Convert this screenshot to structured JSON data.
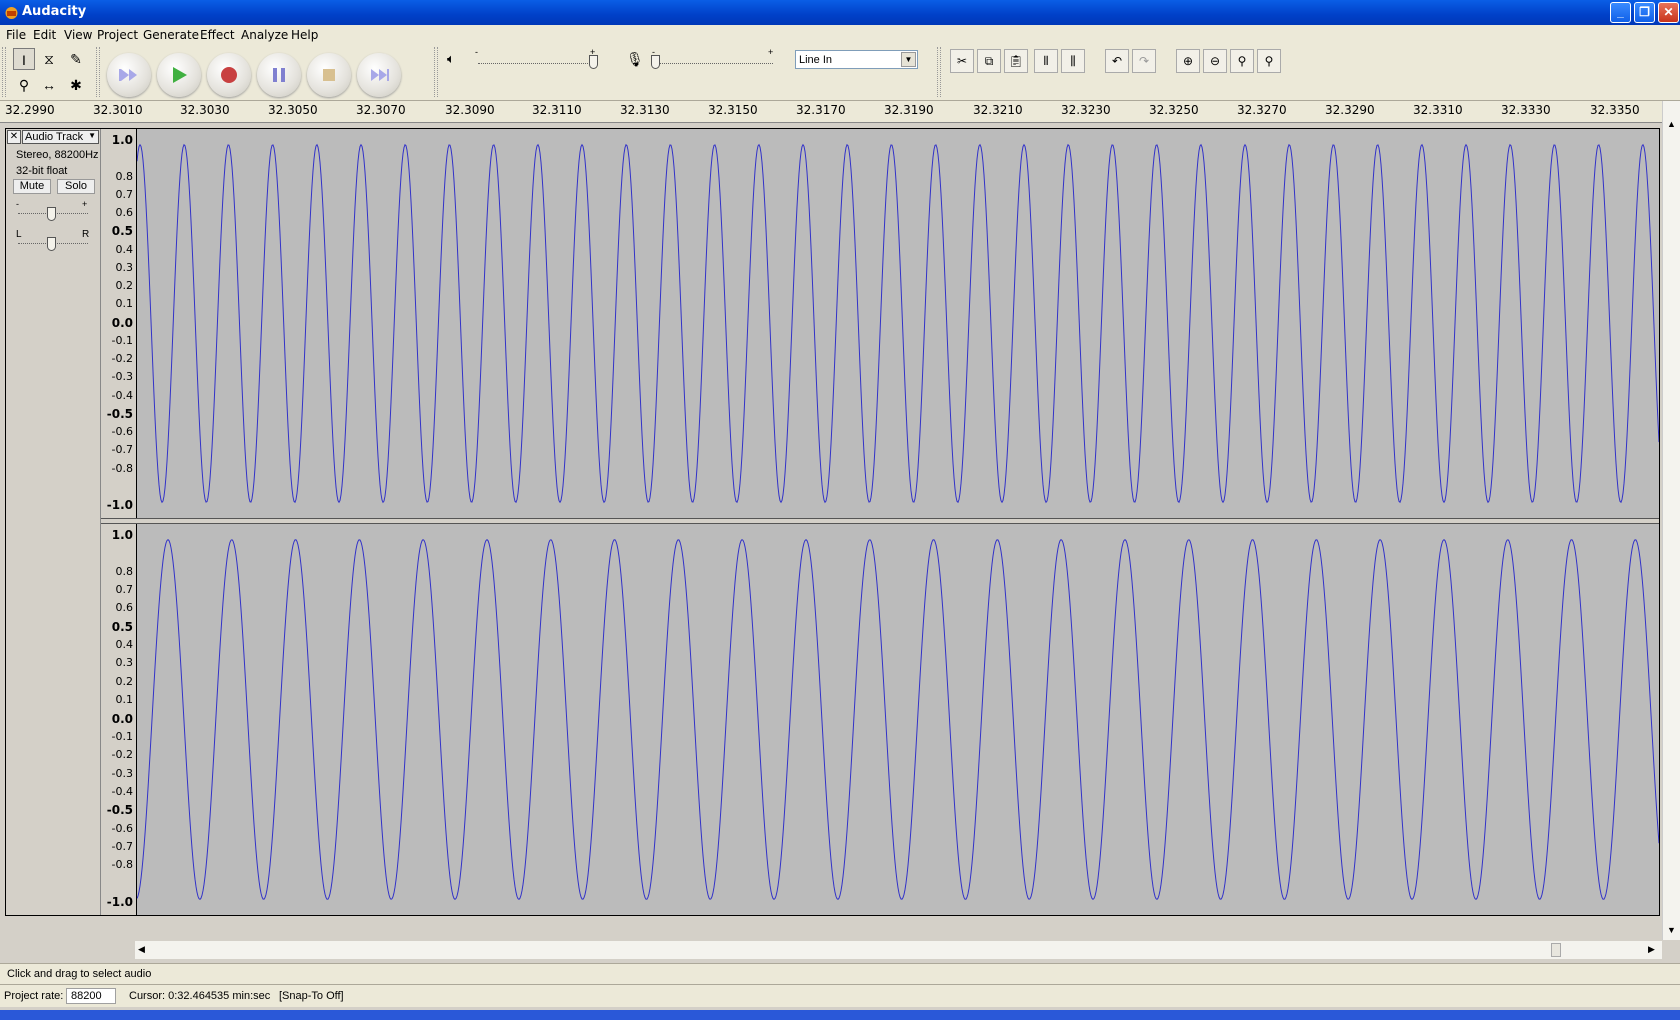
{
  "window": {
    "title": "Audacity",
    "minimize_icon": "minimize-icon",
    "maximize_icon": "restore-icon",
    "close_icon": "close-icon"
  },
  "menu": [
    "File",
    "Edit",
    "View",
    "Project",
    "Generate",
    "Effect",
    "Analyze",
    "Help"
  ],
  "toolbar": {
    "input_source": "Line In",
    "playback_volume_min": "-",
    "playback_volume_max": "+",
    "recording_volume_min": "-",
    "recording_volume_max": "+"
  },
  "ruler": {
    "ticks": [
      "32.2990",
      "32.3010",
      "32.3030",
      "32.3050",
      "32.3070",
      "32.3090",
      "32.3110",
      "32.3130",
      "32.3150",
      "32.3170",
      "32.3190",
      "32.3210",
      "32.3230",
      "32.3250",
      "32.3270",
      "32.3290",
      "32.3310",
      "32.3330",
      "32.3350"
    ]
  },
  "track": {
    "name": "Audio Track",
    "info1": "Stereo, 88200Hz",
    "info2": "32-bit float",
    "mute_label": "Mute",
    "solo_label": "Solo",
    "gain_min": "-",
    "gain_max": "+",
    "pan_left": "L",
    "pan_right": "R",
    "scale": [
      "1.0",
      "0.8",
      "0.7",
      "0.6",
      "0.5",
      "0.4",
      "0.3",
      "0.2",
      "0.1",
      "0.0",
      "-0.1",
      "-0.2",
      "-0.3",
      "-0.4",
      "-0.5",
      "-0.6",
      "-0.7",
      "-0.8",
      "-1.0"
    ]
  },
  "status": {
    "hint": "Click and drag to select audio",
    "project_rate_label": "Project rate:",
    "project_rate_value": "88200",
    "cursor_text": "Cursor: 0:32.464535 min:sec",
    "snap_text": "[Snap-To Off]"
  },
  "colors": {
    "waveform": "#3232c8",
    "track_bg": "#bbbbbb"
  }
}
